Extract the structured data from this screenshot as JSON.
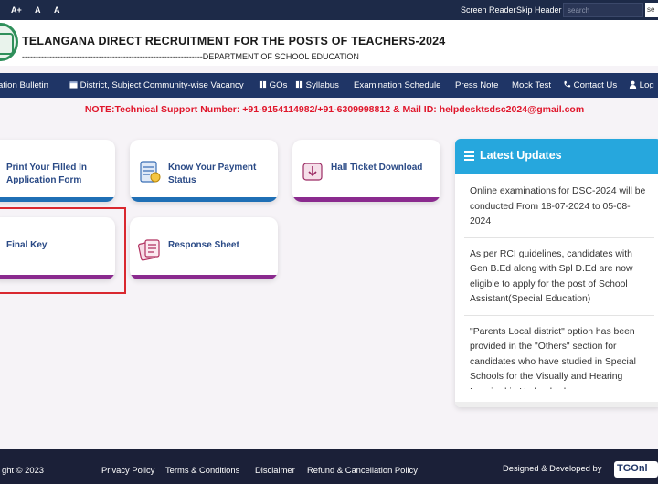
{
  "topbar": {
    "font_larger": "A+",
    "font_normal": "A",
    "font_smaller": "A",
    "screen_reader": "Screen Reader",
    "skip_header": "Skip Header",
    "search_placeholder": "search",
    "search_button": "se"
  },
  "header": {
    "title": "TELANGANA DIRECT RECRUITMENT FOR THE POSTS OF TEACHERS-2024",
    "subtitle": "------------------------------------------------------------------DEPARTMENT OF SCHOOL EDUCATION"
  },
  "nav": {
    "items": [
      {
        "label": "ation Bulletin",
        "icon": "none"
      },
      {
        "label": "District, Subject Community-wise Vacancy",
        "icon": "calendar-icon"
      },
      {
        "label": "GOs",
        "icon": "book-icon"
      },
      {
        "label": "Syllabus",
        "icon": "book-icon"
      },
      {
        "label": "Examination Schedule",
        "icon": "none"
      },
      {
        "label": "Press Note",
        "icon": "none"
      },
      {
        "label": "Mock Test",
        "icon": "none"
      },
      {
        "label": "Contact Us",
        "icon": "phone-icon"
      },
      {
        "label": "Log",
        "icon": "user-icon"
      }
    ]
  },
  "note": "NOTE:Technical Support Number: +91-9154114982/+91-6309998812 & Mail ID: helpdesktsdsc2024@gmail.com",
  "cards": {
    "print_form": "Print Your Filled In Application Form",
    "payment_status": "Know Your Payment Status",
    "hall_ticket": "Hall Ticket Download",
    "final_key": "Final Key",
    "response_sheet": "Response Sheet"
  },
  "updates": {
    "title": "Latest Updates",
    "items": [
      "Online examinations for DSC-2024 will be conducted From 18-07-2024 to 05-08-2024",
      "As per RCI guidelines, candidates with Gen B.Ed along with Spl D.Ed are now eligible to apply for the post of School Assistant(Special Education)",
      "\"Parents Local district\" option has been provided in the \"Others\" section for candidates who have studied in Special Schools for the Visually and Hearing Impaired in Hyderabad."
    ]
  },
  "footer": {
    "copyright": "ght © 2023",
    "privacy": "Privacy Policy",
    "terms": "Terms & Conditions",
    "disclaimer": "Disclaimer",
    "refund": "Refund & Cancellation Policy",
    "designed_by": "Designed & Developed by",
    "brand": "TGOnl"
  },
  "colors": {
    "topbar": "#1d2a48",
    "nav": "#1f3566",
    "note_red": "#e0162b",
    "card_label": "#2a4a86",
    "card_bar_blue": "#1f6fb5",
    "card_bar_purple": "#8a2a8e",
    "updates_header": "#26a7dd",
    "highlight_border": "#d9282f",
    "footer": "#1b2038"
  }
}
